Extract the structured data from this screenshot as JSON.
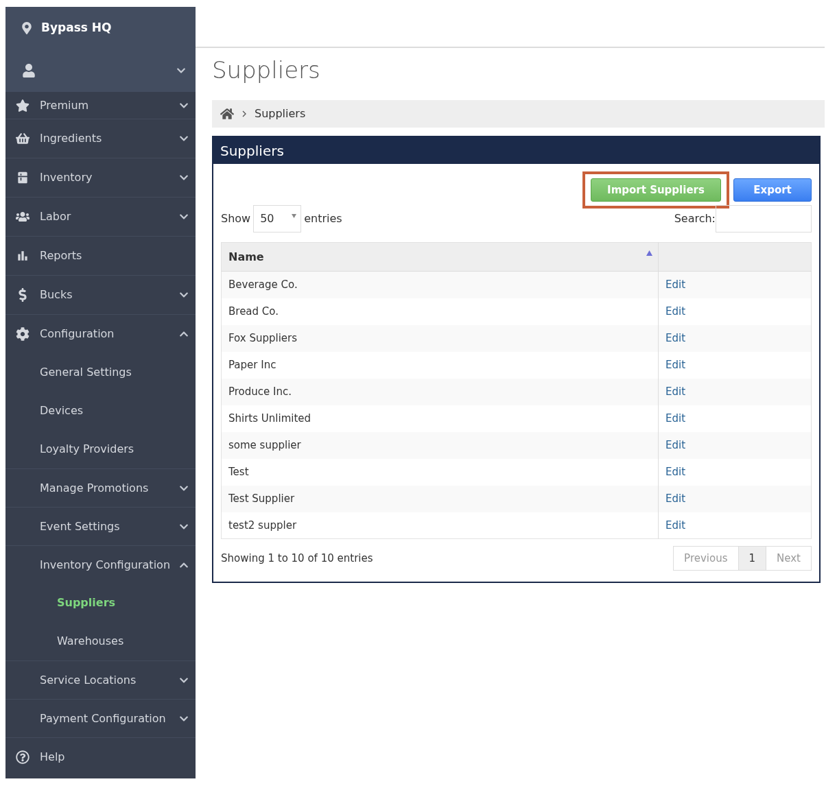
{
  "sidebar": {
    "location": "Bypass HQ",
    "user": {
      "expanded": false
    },
    "items": [
      {
        "label": "Premium",
        "kind": "group",
        "expanded": false
      },
      {
        "label": "Ingredients",
        "kind": "group",
        "expanded": false
      },
      {
        "label": "Inventory",
        "kind": "group",
        "expanded": false
      },
      {
        "label": "Labor",
        "kind": "group",
        "expanded": false
      },
      {
        "label": "Reports",
        "kind": "link"
      },
      {
        "label": "Bucks",
        "kind": "group",
        "expanded": false
      },
      {
        "label": "Configuration",
        "kind": "group",
        "expanded": true,
        "children": [
          {
            "label": "General Settings",
            "kind": "link",
            "selected": false
          },
          {
            "label": "Devices",
            "kind": "link",
            "selected": false
          },
          {
            "label": "Loyalty Providers",
            "kind": "link",
            "selected": false
          },
          {
            "label": "Manage Promotions",
            "kind": "group",
            "expanded": false
          },
          {
            "label": "Event Settings",
            "kind": "group",
            "expanded": false
          },
          {
            "label": "Inventory Configuration",
            "kind": "group",
            "expanded": true,
            "children": [
              {
                "label": "Suppliers",
                "selected": true
              },
              {
                "label": "Warehouses",
                "selected": false
              }
            ]
          },
          {
            "label": "Service Locations",
            "kind": "group",
            "expanded": false
          },
          {
            "label": "Payment Configuration",
            "kind": "group",
            "expanded": false
          }
        ]
      },
      {
        "label": "Help",
        "kind": "link"
      }
    ]
  },
  "page_title": "Suppliers",
  "breadcrumb": [
    "Suppliers"
  ],
  "panel": {
    "title": "Suppliers",
    "buttons": [
      {
        "label": "Import Suppliers",
        "kind": "success",
        "highlighted": true
      },
      {
        "label": "Export",
        "kind": "primary",
        "highlighted": false
      }
    ],
    "length": {
      "prefix": "Show",
      "value": "50",
      "suffix": "entries"
    },
    "search": {
      "label": "Search:"
    },
    "table": {
      "columns": [
        {
          "label": "Name",
          "sort_ascending": true
        }
      ],
      "rows": [
        {
          "name": "Beverage Co.",
          "action": "Edit"
        },
        {
          "name": "Bread Co.",
          "action": "Edit"
        },
        {
          "name": "Fox Suppliers",
          "action": "Edit"
        },
        {
          "name": "Paper Inc",
          "action": "Edit"
        },
        {
          "name": "Produce Inc.",
          "action": "Edit"
        },
        {
          "name": "Shirts Unlimited",
          "action": "Edit"
        },
        {
          "name": "some supplier",
          "action": "Edit"
        },
        {
          "name": "Test",
          "action": "Edit"
        },
        {
          "name": "Test Supplier",
          "action": "Edit"
        },
        {
          "name": "test2 suppler",
          "action": "Edit"
        }
      ]
    },
    "info": "Showing 1 to 10 of 10 entries",
    "pagination": [
      {
        "label": "Previous",
        "selected": false,
        "disabled": true
      },
      {
        "label": "1",
        "selected": true,
        "disabled": false
      },
      {
        "label": "Next",
        "selected": false,
        "disabled": true
      }
    ]
  }
}
